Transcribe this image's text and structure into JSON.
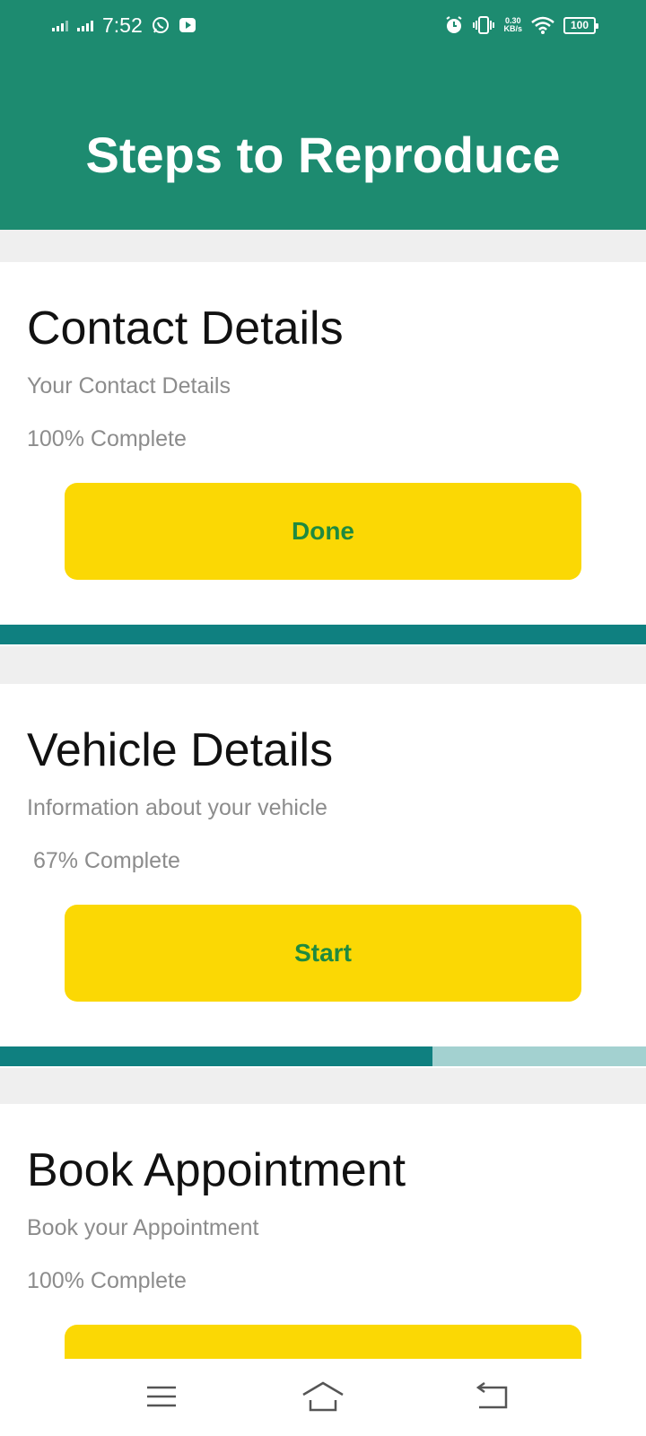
{
  "colors": {
    "header": "#1d8b70",
    "button": "#fbd804",
    "button_text": "#1f8a3f",
    "progress_fill": "#0f8080",
    "progress_track": "#a3d1d0",
    "page_bg": "#efefef"
  },
  "status_bar": {
    "time": "7:52",
    "net_speed_value": "0.30",
    "net_speed_unit": "KB/s",
    "battery": "100",
    "icons": [
      "signal-icon",
      "signal-icon",
      "whatsapp-icon",
      "youtube-icon",
      "alarm-icon",
      "vibrate-icon",
      "wifi-icon",
      "battery-icon"
    ]
  },
  "header": {
    "title": "Steps to Reproduce"
  },
  "steps": [
    {
      "title": "Contact Details",
      "subtitle": "Your Contact Details",
      "progress_text": "100% Complete",
      "progress": 1.0,
      "button_label": "Done"
    },
    {
      "title": "Vehicle Details",
      "subtitle": "Information about your vehicle",
      "progress_text": " 67% Complete",
      "progress": 0.67,
      "button_label": "Start"
    },
    {
      "title": "Book Appointment",
      "subtitle": "Book your Appointment",
      "progress_text": "100% Complete",
      "progress": 1.0,
      "button_label": ""
    }
  ],
  "nav_bar": {
    "icons": [
      "menu-icon",
      "home-icon",
      "back-icon"
    ]
  }
}
